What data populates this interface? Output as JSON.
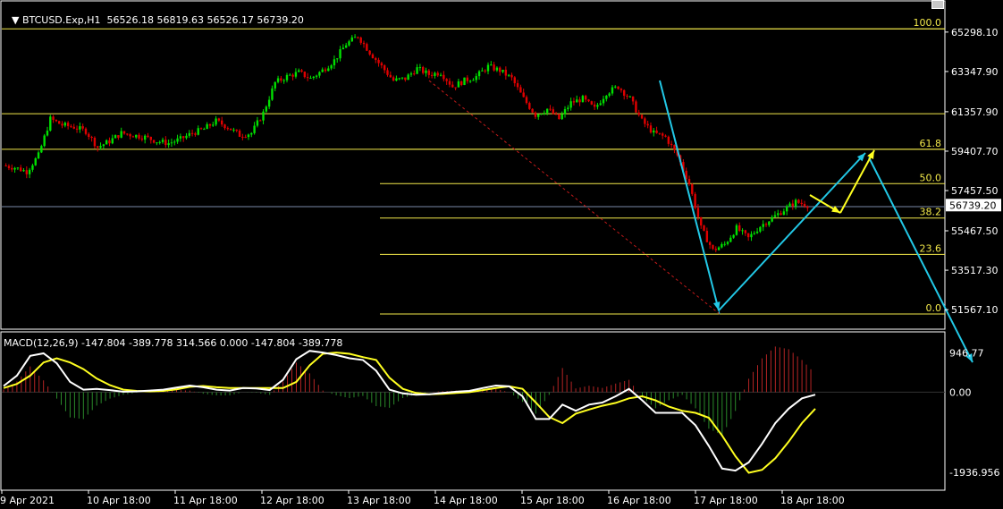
{
  "header": {
    "symbol": "BTCUSD.Exp,H1",
    "ohlc": "56526.18 56819.63 56526.17 56739.20"
  },
  "macd_header": {
    "label": "MACD(12,26,9) -147.804 -389.778 314.566 0.000 -147.804 -389.778"
  },
  "colors": {
    "background": "#000000",
    "bull": "#00e000",
    "bear": "#e00000",
    "fib": "#f2e84a",
    "arrow_cyan": "#22c8e6",
    "arrow_yellow": "#ffff20",
    "grid_text": "#ffffff",
    "trend_line": "#c41a1a",
    "macd_main": "#ffffff",
    "macd_signal": "#ffff20",
    "macd_hist_up": "#b42424",
    "macd_hist_down": "#2a8a2a"
  },
  "chart_data": [
    {
      "type": "candlestick",
      "title": "BTCUSD.Exp,H1",
      "ylim": [
        50600,
        66000
      ],
      "y_ticks": [
        "65298.10",
        "63347.90",
        "61357.90",
        "59407.70",
        "57457.50",
        "55467.50",
        "53517.30",
        "51567.10"
      ],
      "current_price": "56739.20",
      "x_ticks": [
        "9 Apr 2021",
        "10 Apr 18:00",
        "11 Apr 18:00",
        "12 Apr 18:00",
        "13 Apr 18:00",
        "14 Apr 18:00",
        "15 Apr 18:00",
        "16 Apr 18:00",
        "17 Apr 18:00",
        "18 Apr 18:00"
      ],
      "closes_approx": [
        58700,
        58600,
        58400,
        59200,
        61000,
        60700,
        60600,
        60400,
        59600,
        59900,
        60300,
        60200,
        60100,
        59900,
        59800,
        60000,
        60300,
        60500,
        60900,
        60600,
        60200,
        60300,
        61300,
        62800,
        63100,
        63300,
        63000,
        63400,
        63900,
        64700,
        65100,
        64300,
        63600,
        62900,
        63000,
        63500,
        63200,
        63300,
        62600,
        62900,
        63100,
        63600,
        63400,
        63000,
        62000,
        61200,
        61500,
        61000,
        61800,
        62000,
        61500,
        62300,
        62600,
        62000,
        60900,
        60300,
        60100,
        59200,
        57800,
        55600,
        54500,
        54800,
        55600,
        55100,
        55700,
        56100,
        56500,
        56900,
        56739
      ],
      "fibonacci": {
        "levels": [
          {
            "label": "100.0",
            "price": 65460
          },
          {
            "label": "61.8",
            "price": 59500
          },
          {
            "label": "50.0",
            "price": 57800
          },
          {
            "label": "38.2",
            "price": 56100
          },
          {
            "label": "23.6",
            "price": 54300
          },
          {
            "label": "0.0",
            "price": 51350
          }
        ]
      },
      "horizontal_lines": [
        65460,
        61260,
        59500,
        56660
      ],
      "annotations": [
        {
          "kind": "arrow",
          "color": "cyan",
          "from": [
            "16 Apr 18:00",
            60200
          ],
          "to": [
            "17 Apr 18:00",
            51900
          ]
        },
        {
          "kind": "arrow",
          "color": "cyan",
          "from": [
            "17 Apr 18:00",
            51900
          ],
          "to": [
            "18 Apr 18:00+",
            58700
          ]
        },
        {
          "kind": "arrow",
          "color": "cyan",
          "from": [
            "18 Apr 18:00+",
            58700
          ],
          "to": [
            "beyond",
            47500
          ]
        },
        {
          "kind": "arrow",
          "color": "yellow",
          "from": [
            "18 Apr 18:00",
            56800
          ],
          "to": [
            "18 Apr 18:00+",
            56100
          ]
        },
        {
          "kind": "arrow",
          "color": "yellow",
          "from": [
            "18 Apr 18:00+",
            56100
          ],
          "to": [
            "18 Apr 18:00+",
            58700
          ]
        }
      ]
    },
    {
      "type": "macd",
      "title": "MACD(12,26,9)",
      "params": [
        12,
        26,
        9
      ],
      "ylim": [
        -2200,
        1200
      ],
      "y_ticks": [
        "946.77",
        "0.00",
        "-1936.956"
      ],
      "main": [
        150,
        400,
        880,
        940,
        700,
        250,
        60,
        80,
        50,
        10,
        20,
        40,
        60,
        110,
        160,
        120,
        60,
        40,
        100,
        90,
        50,
        300,
        800,
        1000,
        960,
        900,
        820,
        780,
        520,
        60,
        -30,
        -60,
        -50,
        -20,
        10,
        30,
        100,
        160,
        140,
        -100,
        -650,
        -650,
        -300,
        -450,
        -300,
        -250,
        -100,
        80,
        -200,
        -500,
        -500,
        -500,
        -800,
        -1300,
        -1850,
        -1900,
        -1700,
        -1250,
        -750,
        -400,
        -150,
        -60
      ],
      "signal": [
        100,
        200,
        400,
        720,
        820,
        720,
        560,
        330,
        170,
        60,
        30,
        20,
        30,
        70,
        130,
        150,
        120,
        100,
        100,
        100,
        100,
        100,
        250,
        650,
        930,
        960,
        930,
        850,
        780,
        350,
        80,
        -20,
        -50,
        -40,
        -20,
        0,
        50,
        100,
        140,
        80,
        -250,
        -600,
        -750,
        -520,
        -420,
        -330,
        -260,
        -150,
        -100,
        -200,
        -350,
        -450,
        -500,
        -620,
        -1050,
        -1550,
        -1950,
        -1880,
        -1600,
        -1200,
        -750,
        -400
      ]
    }
  ]
}
